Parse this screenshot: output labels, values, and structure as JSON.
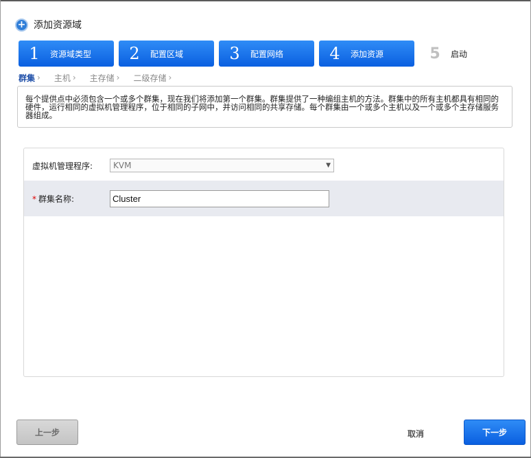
{
  "dialog": {
    "title": "添加资源域",
    "title_icon": "plus-circle-icon"
  },
  "steps": [
    {
      "num": "1",
      "label": "资源域类型"
    },
    {
      "num": "2",
      "label": "配置区域"
    },
    {
      "num": "3",
      "label": "配置网络"
    },
    {
      "num": "4",
      "label": "添加资源"
    },
    {
      "num": "5",
      "label": "启动"
    }
  ],
  "substeps": [
    {
      "label": "群集",
      "chevron": "›"
    },
    {
      "label": "主机",
      "chevron": "›"
    },
    {
      "label": "主存储",
      "chevron": "›"
    },
    {
      "label": "二级存储",
      "chevron": "›"
    }
  ],
  "info_text": "每个提供点中必须包含一个或多个群集，现在我们将添加第一个群集。群集提供了一种编组主机的方法。群集中的所有主机都具有相同的硬件，运行相同的虚拟机管理程序，位于相同的子网中，并访问相同的共享存储。每个群集由一个或多个主机以及一个或多个主存储服务器组成。",
  "form": {
    "hypervisor_label": "虚拟机管理程序:",
    "hypervisor_value": "KVM",
    "cluster_required": "*",
    "cluster_label": "群集名称:",
    "cluster_value": "Cluster"
  },
  "buttons": {
    "prev": "上一步",
    "cancel": "取消",
    "next": "下一步"
  },
  "colors": {
    "accent": "#0a6cf0",
    "required": "#dd0000",
    "active_substep": "#1f4fa8"
  }
}
